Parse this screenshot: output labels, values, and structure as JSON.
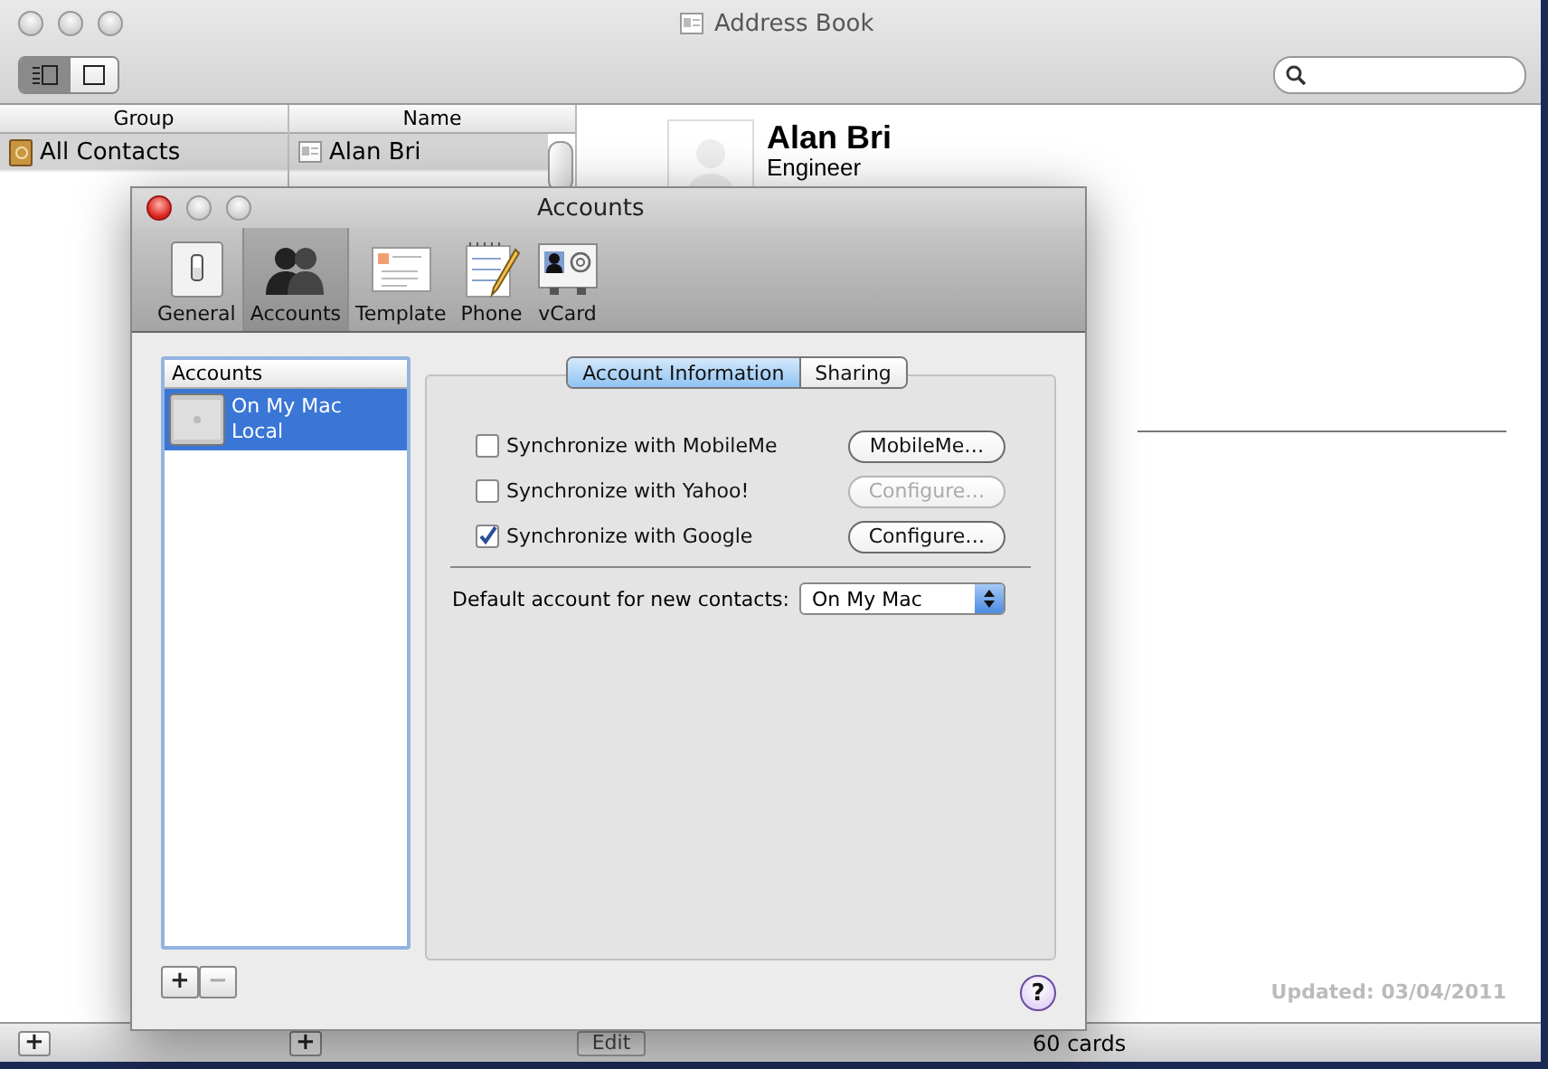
{
  "window": {
    "title": "Address Book"
  },
  "view_buttons": [
    {
      "kind": "columns",
      "selected": true
    },
    {
      "kind": "card",
      "selected": false
    }
  ],
  "group_column": {
    "header": "Group",
    "items": [
      {
        "label": "All Contacts",
        "selected": true
      }
    ]
  },
  "name_column": {
    "header": "Name",
    "items": [
      {
        "label": "Alan Bri",
        "selected": true
      }
    ]
  },
  "card": {
    "name": "Alan Bri",
    "job_title": "Engineer",
    "updated": "Updated: 03/04/2011"
  },
  "status_bar": {
    "edit": "Edit",
    "count": "60 cards"
  },
  "dialog": {
    "title": "Accounts",
    "toolbar": [
      {
        "kind": "switch",
        "label": "General",
        "selected": false
      },
      {
        "kind": "people",
        "label": "Accounts",
        "selected": true
      },
      {
        "kind": "template",
        "label": "Template",
        "selected": false
      },
      {
        "kind": "phone",
        "label": "Phone",
        "selected": false
      },
      {
        "kind": "vcard",
        "label": "vCard",
        "selected": false
      }
    ],
    "accounts_list": {
      "header": "Accounts",
      "items": [
        {
          "name": "On My Mac",
          "detail": "Local",
          "selected": true
        }
      ]
    },
    "list_buttons": [
      {
        "label": "+",
        "disabled": false
      },
      {
        "label": "−",
        "disabled": true
      }
    ],
    "tabs": [
      {
        "label": "Account Information",
        "selected": true
      },
      {
        "label": "Sharing",
        "selected": false
      }
    ],
    "sync": [
      {
        "label": "Synchronize with MobileMe",
        "checked": false,
        "button": "MobileMe…",
        "button_disabled": false
      },
      {
        "label": "Synchronize with Yahoo!",
        "checked": false,
        "button": "Configure…",
        "button_disabled": true
      },
      {
        "label": "Synchronize with Google",
        "checked": true,
        "button": "Configure…",
        "button_disabled": false
      }
    ],
    "default_account": {
      "label": "Default account for new contacts:",
      "value": "On My Mac"
    },
    "help": "?"
  },
  "add_buttons": [
    "+",
    "+"
  ]
}
